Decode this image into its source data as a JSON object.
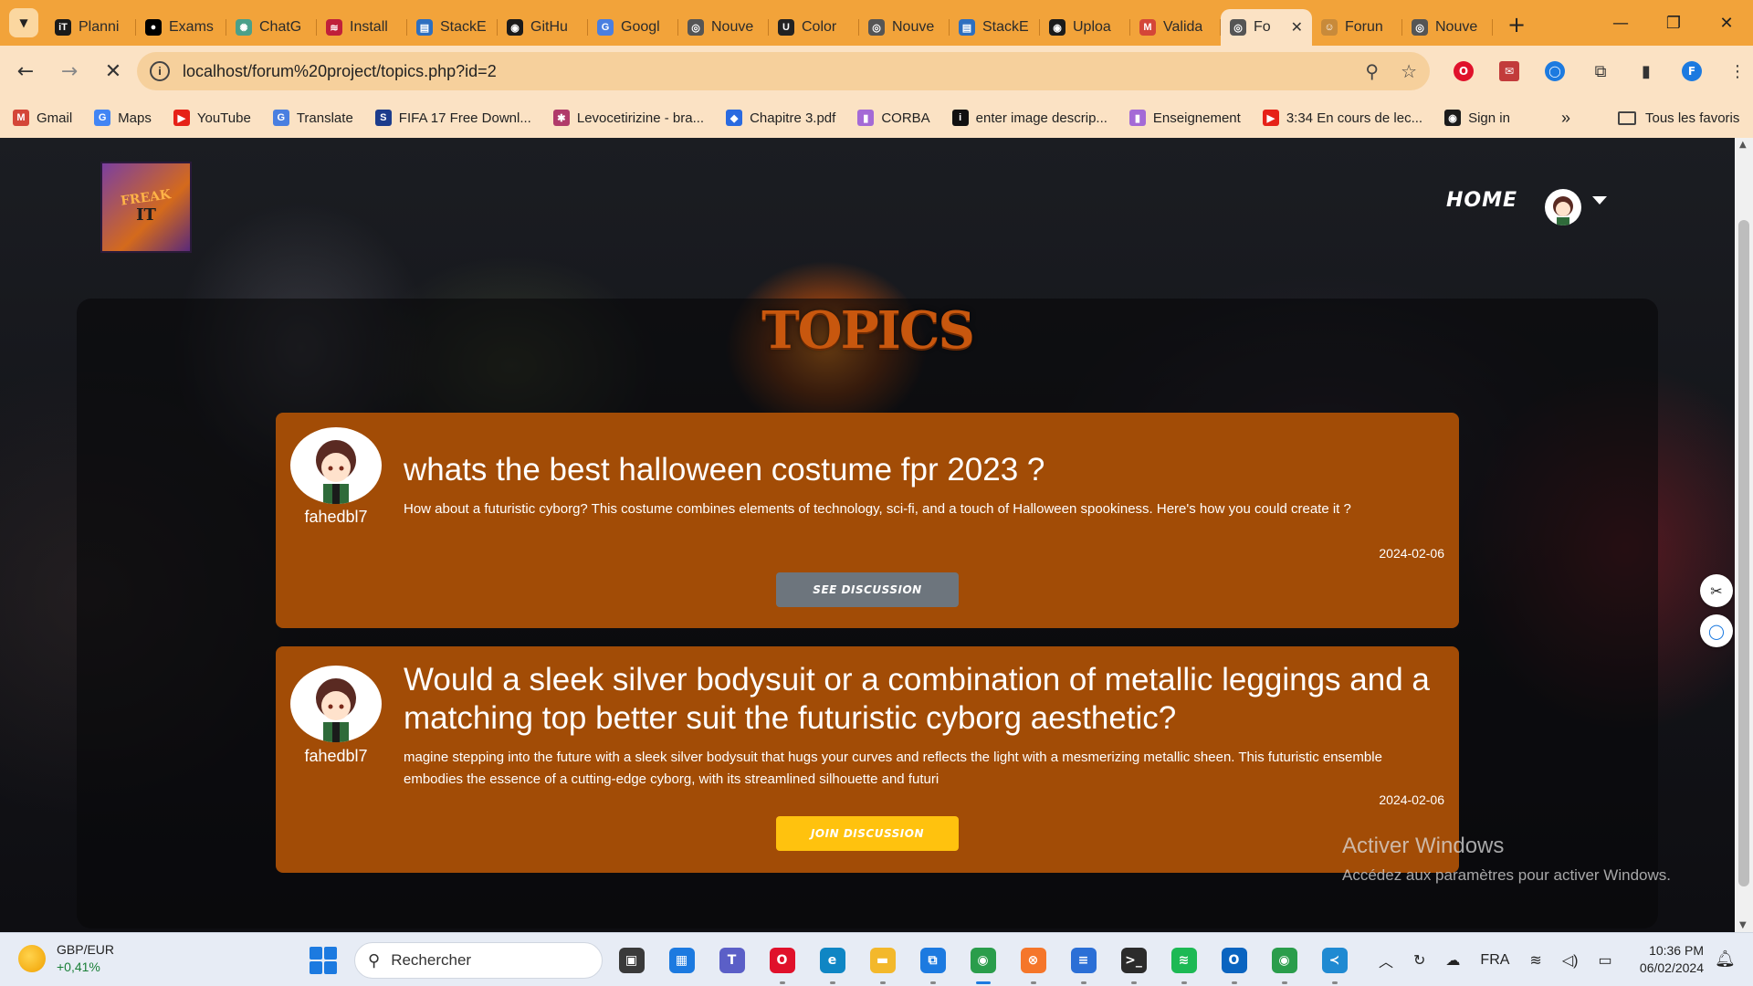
{
  "browser": {
    "tabs": [
      {
        "title": "Planni",
        "icon": "it-icon",
        "color": "#1a1a1a",
        "glyph": "iT"
      },
      {
        "title": "Exams",
        "icon": "dot-icon",
        "color": "#000000",
        "glyph": "●"
      },
      {
        "title": "ChatG",
        "icon": "chatgpt-icon",
        "color": "#4aa08a",
        "glyph": "✺"
      },
      {
        "title": "Install",
        "icon": "stackshare-icon",
        "color": "#c0203a",
        "glyph": "≋"
      },
      {
        "title": "StackE",
        "icon": "stackexchange-icon",
        "color": "#2d6fc0",
        "glyph": "▤"
      },
      {
        "title": "GitHu",
        "icon": "github-icon",
        "color": "#1b1b1b",
        "glyph": "◉"
      },
      {
        "title": "Googl",
        "icon": "google-translate-icon",
        "color": "#4a7fe0",
        "glyph": "G"
      },
      {
        "title": "Nouve",
        "icon": "chrome-icon",
        "color": "#555555",
        "glyph": "◎"
      },
      {
        "title": "Color",
        "icon": "color-icon",
        "color": "#222222",
        "glyph": "U"
      },
      {
        "title": "Nouve",
        "icon": "chrome-icon",
        "color": "#555555",
        "glyph": "◎"
      },
      {
        "title": "StackE",
        "icon": "stackexchange-icon",
        "color": "#2d6fc0",
        "glyph": "▤"
      },
      {
        "title": "Uploa",
        "icon": "github-icon",
        "color": "#1b1b1b",
        "glyph": "◉"
      },
      {
        "title": "Valida",
        "icon": "gmail-icon",
        "color": "#d44638",
        "glyph": "M"
      },
      {
        "title": "Fo",
        "icon": "chrome-icon",
        "color": "#555555",
        "glyph": "◎",
        "active": true
      },
      {
        "title": "Forun",
        "icon": "forum-icon",
        "color": "#c88a3a",
        "glyph": "☺"
      },
      {
        "title": "Nouve",
        "icon": "chrome-icon",
        "color": "#555555",
        "glyph": "◎"
      }
    ],
    "url": "localhost/forum%20project/topics.php?id=2",
    "profile_initial": "F",
    "bookmarks": [
      {
        "label": "Gmail",
        "icon": "gmail-icon",
        "color": "#d44638",
        "glyph": "M"
      },
      {
        "label": "Maps",
        "icon": "google-icon",
        "color": "#4285f4",
        "glyph": "G"
      },
      {
        "label": "YouTube",
        "icon": "youtube-icon",
        "color": "#e62117",
        "glyph": "▶"
      },
      {
        "label": "Translate",
        "icon": "translate-icon",
        "color": "#4a7fe0",
        "glyph": "G"
      },
      {
        "label": "FIFA 17 Free Downl...",
        "icon": "s-icon",
        "color": "#1c3c8c",
        "glyph": "S"
      },
      {
        "label": "Levocetirizine - bra...",
        "icon": "molecule-icon",
        "color": "#b03a6a",
        "glyph": "✱"
      },
      {
        "label": "Chapitre 3.pdf",
        "icon": "dropbox-icon",
        "color": "#2a6ae0",
        "glyph": "◆"
      },
      {
        "label": "CORBA",
        "icon": "bookmark-icon",
        "color": "#a46ad6",
        "glyph": "▮"
      },
      {
        "label": "enter image descrip...",
        "icon": "info-icon",
        "color": "#111111",
        "glyph": "i"
      },
      {
        "label": "Enseignement",
        "icon": "bookmark-icon",
        "color": "#a46ad6",
        "glyph": "▮"
      },
      {
        "label": "3:34 En cours de lec...",
        "icon": "youtube-icon",
        "color": "#e62117",
        "glyph": "▶"
      },
      {
        "label": "Sign in",
        "icon": "github-icon",
        "color": "#1b1b1b",
        "glyph": "◉"
      }
    ],
    "all_bookmarks_label": "Tous les favoris"
  },
  "site": {
    "logo_text": "FREAK",
    "logo_sub": "IT",
    "nav_home": "HOME",
    "heading": "TOPICS",
    "topics": [
      {
        "username": "fahedbl7",
        "title": "whats the best halloween costume fpr 2023 ?",
        "description": "How about a futuristic cyborg? This costume combines elements of technology, sci-fi, and a touch of Halloween spookiness. Here's how you could create it ?",
        "date": "2024-02-06",
        "button": "SEE DISCUSSION"
      },
      {
        "username": "fahedbl7",
        "title": "Would a sleek silver bodysuit or a combination of metallic leggings and a matching top better suit the futuristic cyborg aesthetic?",
        "description": "magine stepping into the future with a sleek silver bodysuit that hugs your curves and reflects the light with a mesmerizing metallic sheen. This futuristic ensemble embodies the essence of a cutting-edge cyborg, with its streamlined silhouette and futuri",
        "date": "2024-02-06",
        "button": "JOIN DISCUSSION"
      }
    ],
    "colors": {
      "card": "#a24c06",
      "heading": "#c8570e",
      "see_button": "#6d757d",
      "join_button": "#ffc20e"
    }
  },
  "watermark": {
    "line1": "Activer Windows",
    "line2": "Accédez aux paramètres pour activer Windows."
  },
  "taskbar": {
    "ticker_name": "GBP/EUR",
    "ticker_change": "+0,41%",
    "search_placeholder": "Rechercher",
    "language": "FRA",
    "time": "10:36 PM",
    "date": "06/02/2024",
    "apps": [
      {
        "name": "taskview-icon",
        "color": "#3a3a3a",
        "glyph": "▣"
      },
      {
        "name": "store-icon",
        "color": "#1c7ae0",
        "glyph": "▦"
      },
      {
        "name": "teams-icon",
        "color": "#5b5fc7",
        "glyph": "T"
      },
      {
        "name": "opera-icon",
        "color": "#e0112b",
        "glyph": "O"
      },
      {
        "name": "edge-icon",
        "color": "#0f86c4",
        "glyph": "e"
      },
      {
        "name": "file-explorer-icon",
        "color": "#f3b82b",
        "glyph": "▬"
      },
      {
        "name": "snip-icon",
        "color": "#1c7ae0",
        "glyph": "⧉"
      },
      {
        "name": "chrome-icon",
        "color": "#2a9d4b",
        "glyph": "◉",
        "active": true
      },
      {
        "name": "xampp-icon",
        "color": "#f5762a",
        "glyph": "⊗"
      },
      {
        "name": "notepad-icon",
        "color": "#2b6fd6",
        "glyph": "≡"
      },
      {
        "name": "terminal-icon",
        "color": "#2b2b2b",
        "glyph": ">_"
      },
      {
        "name": "spotify-icon",
        "color": "#1db954",
        "glyph": "≋"
      },
      {
        "name": "outlook-icon",
        "color": "#0a64c0",
        "glyph": "O"
      },
      {
        "name": "chrome-alt-icon",
        "color": "#2a9d4b",
        "glyph": "◉"
      },
      {
        "name": "vscode-icon",
        "color": "#1f8ad2",
        "glyph": "≺"
      }
    ]
  }
}
